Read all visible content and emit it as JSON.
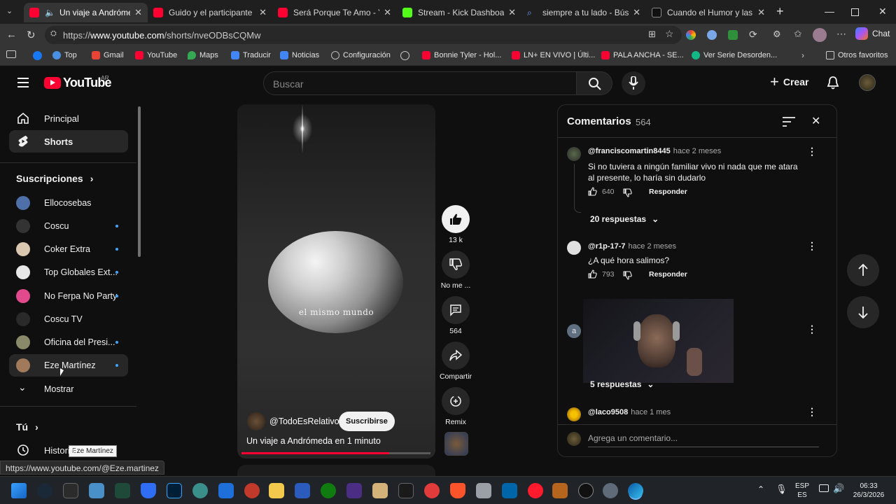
{
  "browser": {
    "tabs": [
      {
        "title": "Un viaje a Andrómeda en",
        "active": true,
        "color": "#ff0033"
      },
      {
        "title": "Guido y el participante que e",
        "active": false,
        "color": "#ff0033"
      },
      {
        "title": "Será Porque Te Amo - YouTub",
        "active": false,
        "color": "#ff0033"
      },
      {
        "title": "Stream - Kick Dashboard",
        "active": false,
        "color": "#53fc18"
      },
      {
        "title": "siempre a tu lado - Búsqueda",
        "active": false,
        "color": "#3b82f6"
      },
      {
        "title": "Cuando el Humor y las Mate",
        "active": false,
        "color": "#111111"
      }
    ],
    "url_prefix": "https://",
    "url_host": "www.youtube.com",
    "url_path": "/shorts/nveODBsCQMw",
    "chat_label": "Chat",
    "bookmarks": [
      {
        "label": "Top",
        "color": "#4a90e2"
      },
      {
        "label": "Gmail",
        "color": "#ea4335"
      },
      {
        "label": "YouTube",
        "color": "#ff0033"
      },
      {
        "label": "Maps",
        "color": "#34a853"
      },
      {
        "label": "Traducir",
        "color": "#4285f4"
      },
      {
        "label": "Noticias",
        "color": "#4285f4"
      },
      {
        "label": "Configuración",
        "color": "#9aa0a6"
      },
      {
        "label": "Bonnie Tyler - Hol...",
        "color": "#ff0033"
      },
      {
        "label": "LN+ EN VIVO | Últi...",
        "color": "#ff0033"
      },
      {
        "label": "PALA ANCHA - SE...",
        "color": "#ff0033"
      },
      {
        "label": "Ver Serie Desorden...",
        "color": "#12b886"
      }
    ],
    "other_bookmarks": "Otros favoritos",
    "status_url": "https://www.youtube.com/@Eze.martinez"
  },
  "masthead": {
    "logo_text": "YouTube",
    "region": "AR",
    "search_placeholder": "Buscar",
    "create_label": "Crear"
  },
  "sidebar": {
    "main": [
      {
        "label": "Principal",
        "icon": "home-icon"
      },
      {
        "label": "Shorts",
        "icon": "shorts-icon"
      }
    ],
    "subscriptions_title": "Suscripciones",
    "subscriptions": [
      {
        "label": "Ellocosebas",
        "new": false,
        "color": "#4f6fa8"
      },
      {
        "label": "Coscu",
        "new": true,
        "color": "#333333"
      },
      {
        "label": "Coker Extra",
        "new": true,
        "color": "#d9c7b0"
      },
      {
        "label": "Top Globales Ext...",
        "new": true,
        "color": "#e8e8e8"
      },
      {
        "label": "No Ferpa No Party",
        "new": true,
        "color": "#e24a8d"
      },
      {
        "label": "Coscu TV",
        "new": false,
        "color": "#2a2a2a"
      },
      {
        "label": "Oficina del Presi...",
        "new": true,
        "color": "#8a8a6a"
      },
      {
        "label": "Eze Martínez",
        "new": true,
        "color": "#a07a5a"
      }
    ],
    "show_more": "Mostrar",
    "you_title": "Tú",
    "history": "Historial",
    "tooltip": "Eze Martínez"
  },
  "short": {
    "overlay_text": "el mismo mundo",
    "channel": "@TodoEsRelativo",
    "subscribe": "Suscribirse",
    "title": "Un viaje a Andrómeda en 1 minuto",
    "progress": 0.78,
    "actions": {
      "likes": "13 k",
      "dislike": "No me ...",
      "comments": "564",
      "share": "Compartir",
      "remix": "Remix"
    }
  },
  "comments": {
    "title": "Comentarios",
    "count": "564",
    "items": [
      {
        "user": "@franciscomartin8445",
        "time": "hace 2 meses",
        "text": "Si no tuviera a ningún familiar vivo ni nada que me atara al presente, lo haría sin dudarlo",
        "likes": "640",
        "reply": "Responder",
        "replies": "20 respuestas"
      },
      {
        "user": "@r1p-17-7",
        "time": "hace 2 meses",
        "text": "¿A qué hora salimos?",
        "likes": "793",
        "reply": "Responder",
        "replies": "5 respuestas"
      },
      {
        "user": "@laco9508",
        "time": "hace 1 mes",
        "text": "",
        "likes": "",
        "reply": "",
        "replies": ""
      }
    ],
    "avatar_letter": "a",
    "add_placeholder": "Agrega un comentario..."
  },
  "taskbar": {
    "lang_top": "ESP",
    "lang_bottom": "ES",
    "time": "06:33",
    "date": "26/3/2026"
  }
}
